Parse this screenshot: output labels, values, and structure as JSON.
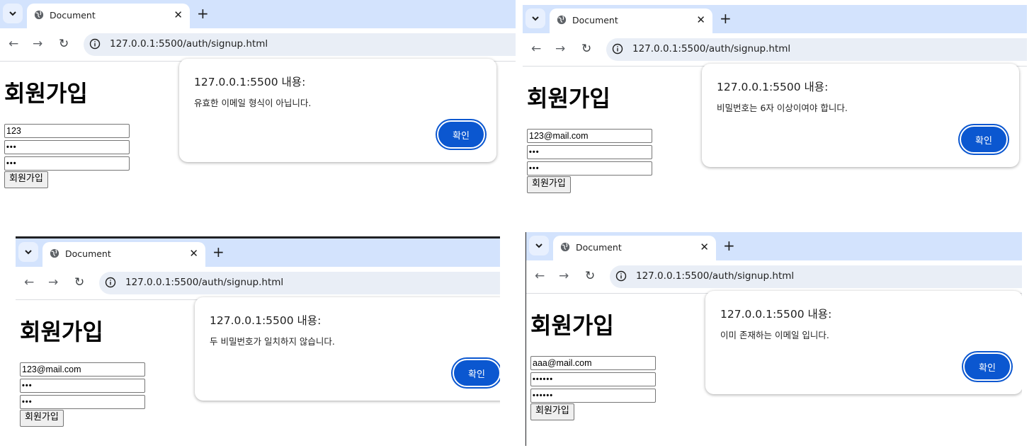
{
  "browser": {
    "tab_title": "Document",
    "url": "127.0.0.1:5500/auth/signup.html",
    "tab_close": "✕",
    "new_tab": "+",
    "back": "←",
    "forward": "→",
    "reload": "↻"
  },
  "page": {
    "title": "회원가입",
    "submit_label": "회원가입"
  },
  "dialog": {
    "origin": "127.0.0.1:5500 내용:",
    "ok_label": "확인"
  },
  "panels": [
    {
      "email": "123",
      "password": "•••",
      "password_confirm": "•••",
      "message": "유효한 이메일 형식이 아닙니다."
    },
    {
      "email": "123@mail.com",
      "password": "•••",
      "password_confirm": "•••",
      "message": "비밀번호는 6자 이상이여야 합니다."
    },
    {
      "email": "123@mail.com",
      "password": "•••",
      "password_confirm": "•••",
      "message": "두 비밀번호가 일치하지 않습니다."
    },
    {
      "email": "aaa@mail.com",
      "password": "••••••",
      "password_confirm": "••••••",
      "message": "이미 존재하는 이메일 입니다."
    }
  ]
}
